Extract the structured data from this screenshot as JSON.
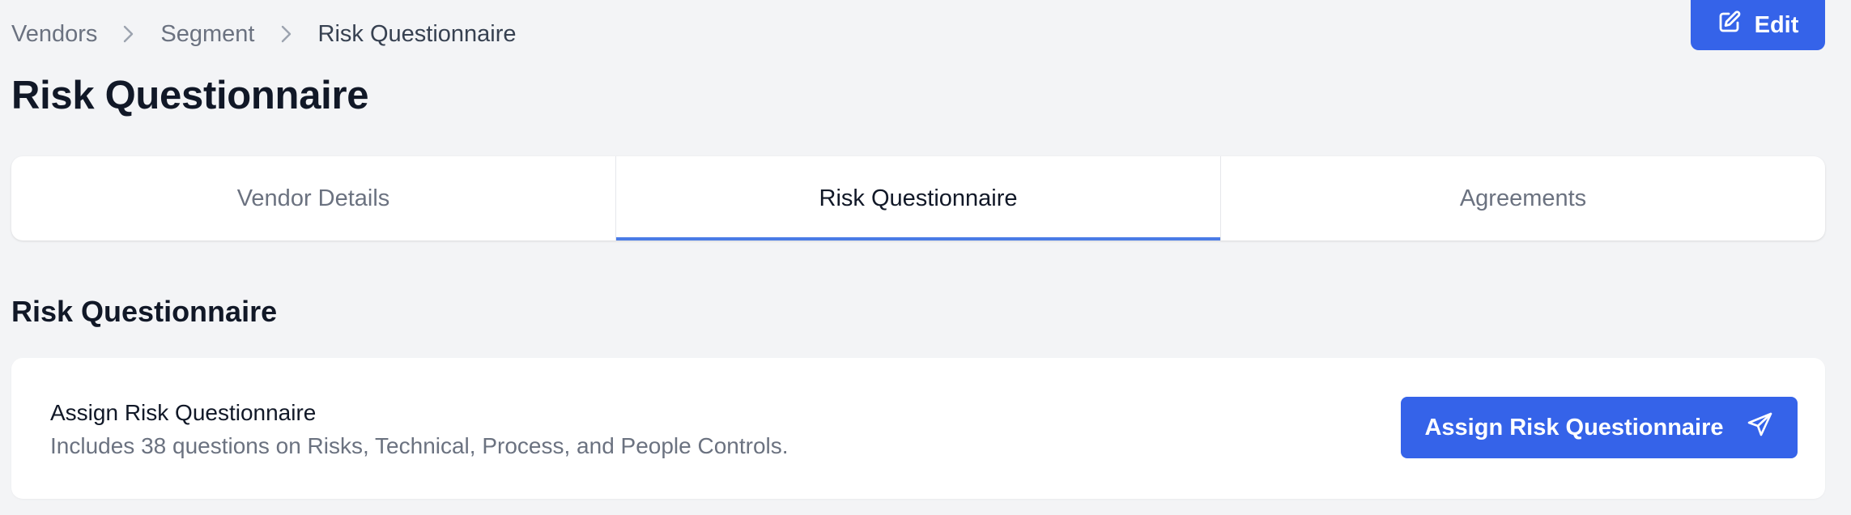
{
  "breadcrumb": {
    "items": [
      "Vendors",
      "Segment",
      "Risk Questionnaire"
    ],
    "separator_icon": "chevron-right-icon"
  },
  "header": {
    "title": "Risk Questionnaire",
    "edit_label": "Edit",
    "edit_icon": "edit-icon"
  },
  "tabs": [
    {
      "label": "Vendor Details",
      "active": false
    },
    {
      "label": "Risk Questionnaire",
      "active": true
    },
    {
      "label": "Agreements",
      "active": false
    }
  ],
  "section": {
    "title": "Risk Questionnaire"
  },
  "card": {
    "title": "Assign Risk Questionnaire",
    "description": "Includes 38 questions on Risks, Technical, Process, and People Controls.",
    "button_label": "Assign Risk Questionnaire",
    "button_icon": "send-icon"
  },
  "colors": {
    "accent": "#3563e9",
    "tab_indicator": "#4a7be6",
    "background": "#f3f4f6"
  }
}
